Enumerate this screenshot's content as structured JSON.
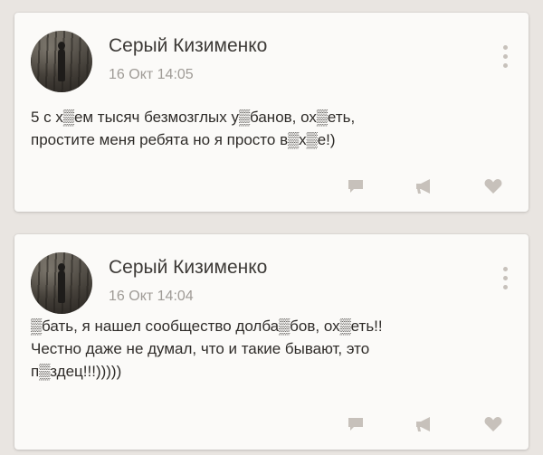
{
  "posts": [
    {
      "author": "Серый Кизименко",
      "date": "16 Окт 14:05",
      "lines": [
        "5 с х▒ем тысяч безмозглых у▒банов, ох▒еть,",
        "простите меня ребята но я просто в▒х▒е!)"
      ]
    },
    {
      "author": "Серый Кизименко",
      "date": "16 Окт 14:04",
      "lines": [
        "▒бать, я нашел сообщество долба▒бов, ох▒еть!!",
        "Честно даже не думал, что и такие бывают, это",
        "п▒здец!!!)))))"
      ]
    }
  ],
  "icons": {
    "comment": "comment-icon",
    "share": "megaphone-icon",
    "like": "heart-icon",
    "menu": "more-vertical-icon"
  },
  "colors": {
    "background": "#e9e5e1",
    "card": "#fbfaf8",
    "author": "#3d3a37",
    "date": "#9f9b96",
    "icon": "#c7c1bb"
  }
}
